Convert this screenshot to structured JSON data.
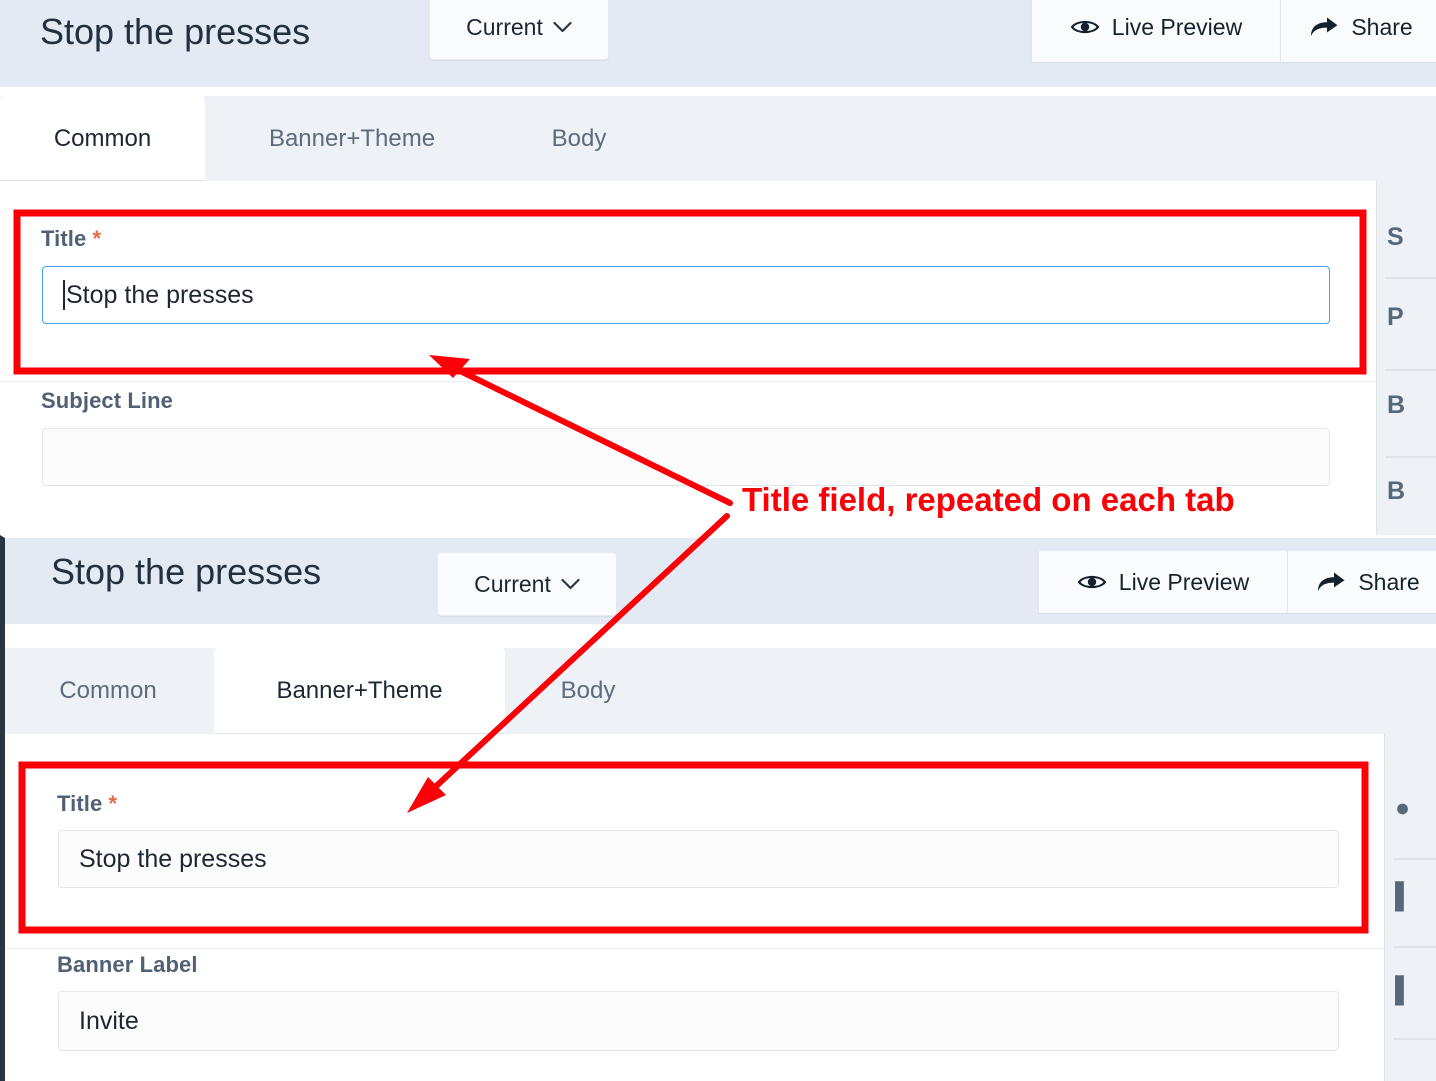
{
  "colors": {
    "annotation_red": "#fb0007",
    "header_bg": "#e3eaf3",
    "tabstrip_bg": "#eef2f6",
    "active_tab_bg": "#ffffff",
    "focus_border": "#3da5e8",
    "required_asterisk": "#e8684a",
    "label_text": "#516074",
    "panel_divider": "#2a3542"
  },
  "annotation": {
    "text": "Title field, repeated on each tab",
    "color": "#fb0007"
  },
  "panels": [
    {
      "id": "common-tab-screenshot",
      "header": {
        "title": "Stop the presses",
        "version_select": {
          "label": "Current",
          "icon": "chevron-down-icon"
        },
        "actions": [
          {
            "label": "Live Preview",
            "icon": "eye-icon"
          },
          {
            "label": "Share",
            "icon": "share-arrow-icon"
          }
        ]
      },
      "tabs": [
        {
          "label": "Common",
          "active": true
        },
        {
          "label": "Banner+Theme",
          "active": false
        },
        {
          "label": "Body",
          "active": false
        }
      ],
      "fields": [
        {
          "label": "Title",
          "required": true,
          "required_marker": "*",
          "value": "Stop the presses",
          "placeholder": "",
          "focused": true,
          "highlighted": true
        },
        {
          "label": "Subject Line",
          "required": false,
          "required_marker": "",
          "value": "",
          "placeholder": "",
          "focused": false,
          "highlighted": false
        }
      ],
      "right_rail": [
        {
          "label": "S"
        },
        {
          "label": "P"
        },
        {
          "label": "B"
        },
        {
          "label": "B"
        }
      ]
    },
    {
      "id": "banner-theme-tab-screenshot",
      "header": {
        "title": "Stop the presses",
        "version_select": {
          "label": "Current",
          "icon": "chevron-down-icon"
        },
        "actions": [
          {
            "label": "Live Preview",
            "icon": "eye-icon"
          },
          {
            "label": "Share",
            "icon": "share-arrow-icon"
          }
        ]
      },
      "tabs": [
        {
          "label": "Common",
          "active": false
        },
        {
          "label": "Banner+Theme",
          "active": true
        },
        {
          "label": "Body",
          "active": false
        }
      ],
      "fields": [
        {
          "label": "Title",
          "required": true,
          "required_marker": "*",
          "value": "Stop the presses",
          "placeholder": "",
          "focused": false,
          "highlighted": true
        },
        {
          "label": "Banner Label",
          "required": false,
          "required_marker": "",
          "value": "Invite",
          "placeholder": "",
          "focused": false,
          "highlighted": false
        }
      ],
      "right_rail": [
        {
          "label": "●"
        },
        {
          "label": "▌"
        },
        {
          "label": "▌"
        },
        {
          "label": ""
        }
      ]
    }
  ]
}
